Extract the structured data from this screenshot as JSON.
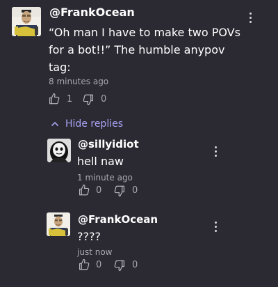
{
  "comments": [
    {
      "username": "@FrankOcean",
      "text_lines": [
        "“Oh man I have to make two POVs",
        "for a bot!!” The humble anypov",
        "tag:"
      ],
      "timestamp": "8 minutes ago",
      "likes": "1",
      "dislikes": "0"
    }
  ],
  "hide_replies_label": "Hide replies",
  "replies": [
    {
      "username": "@sillyidiot",
      "text": "hell naw",
      "timestamp": "1 minute ago",
      "likes": "0",
      "dislikes": "0"
    },
    {
      "username": "@FrankOcean",
      "text": "????",
      "timestamp": "just now",
      "likes": "0",
      "dislikes": "0"
    }
  ],
  "icons": {
    "like": "thumbs-up-icon",
    "dislike": "thumbs-down-icon",
    "more": "more-options-icon",
    "collapse": "chevron-up-icon"
  },
  "colors": {
    "background": "#2b2a33",
    "accent": "#a9a4f4",
    "muted_text": "#a8a7b2"
  }
}
